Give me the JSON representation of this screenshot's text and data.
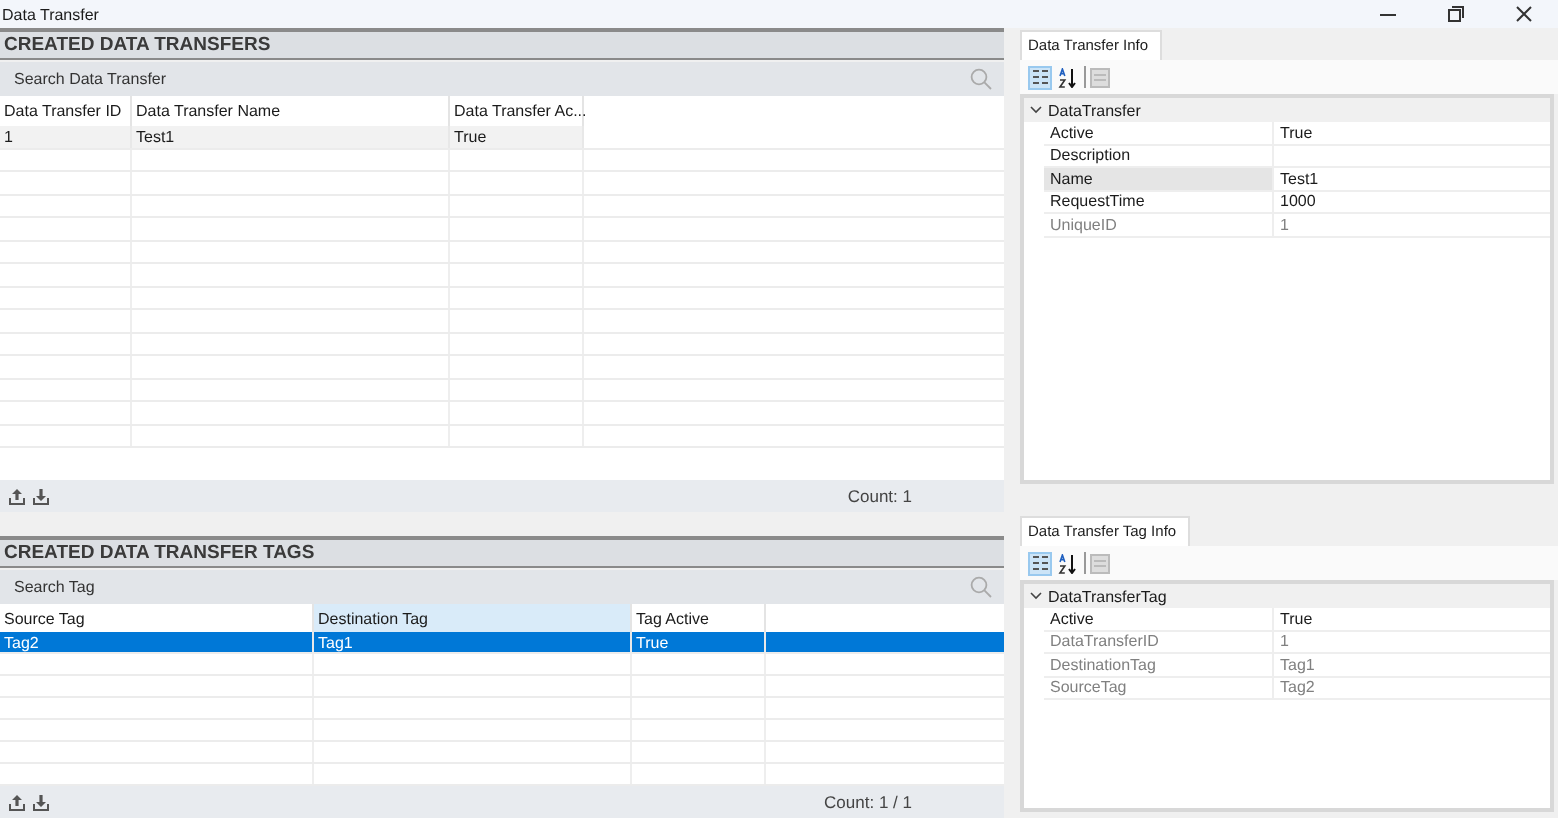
{
  "window": {
    "title": "Data Transfer"
  },
  "sections": [
    {
      "title": "CREATED DATA TRANSFERS",
      "search": {
        "placeholder": "Search Data Transfer"
      },
      "columns": [
        {
          "label": "Data Transfer ID",
          "highlighted": false
        },
        {
          "label": "Data Transfer Name",
          "highlighted": false
        },
        {
          "label": "Data Transfer Ac...",
          "highlighted": false
        }
      ],
      "rows": [
        {
          "cells": [
            "1",
            "Test1",
            "True"
          ],
          "selected": false
        }
      ],
      "count": "Count: 1"
    },
    {
      "title": "CREATED DATA TRANSFER TAGS",
      "search": {
        "placeholder": "Search Tag"
      },
      "columns": [
        {
          "label": "Source Tag",
          "highlighted": false
        },
        {
          "label": "Destination Tag",
          "highlighted": true
        },
        {
          "label": "Tag Active",
          "highlighted": false
        }
      ],
      "rows": [
        {
          "cells": [
            "Tag2",
            "Tag1",
            "True"
          ],
          "selected": true
        }
      ],
      "count": "Count: 1 / 1"
    }
  ],
  "property_panels": [
    {
      "tab": "Data Transfer Info",
      "categorized": true,
      "category": "DataTransfer",
      "expanded": true,
      "properties": [
        {
          "name": "Active",
          "value": "True",
          "readonly": false,
          "selected": false
        },
        {
          "name": "Description",
          "readonly": false,
          "selected": false
        },
        {
          "name": "Name",
          "value": "Test1",
          "readonly": false,
          "selected": true
        },
        {
          "name": "RequestTime",
          "value": "1000",
          "readonly": false,
          "selected": false
        },
        {
          "name": "UniqueID",
          "value": "1",
          "readonly": true,
          "selected": false
        }
      ]
    },
    {
      "tab": "Data Transfer Tag Info",
      "categorized": true,
      "category": "DataTransferTag",
      "expanded": true,
      "properties": [
        {
          "name": "Active",
          "value": "True",
          "readonly": false,
          "selected": false
        },
        {
          "name": "DataTransferID",
          "value": "1",
          "readonly": true,
          "selected": false
        },
        {
          "name": "DestinationTag",
          "value": "Tag1",
          "readonly": true,
          "selected": false
        },
        {
          "name": "SourceTag",
          "value": "Tag2",
          "readonly": true,
          "selected": false
        }
      ]
    }
  ]
}
